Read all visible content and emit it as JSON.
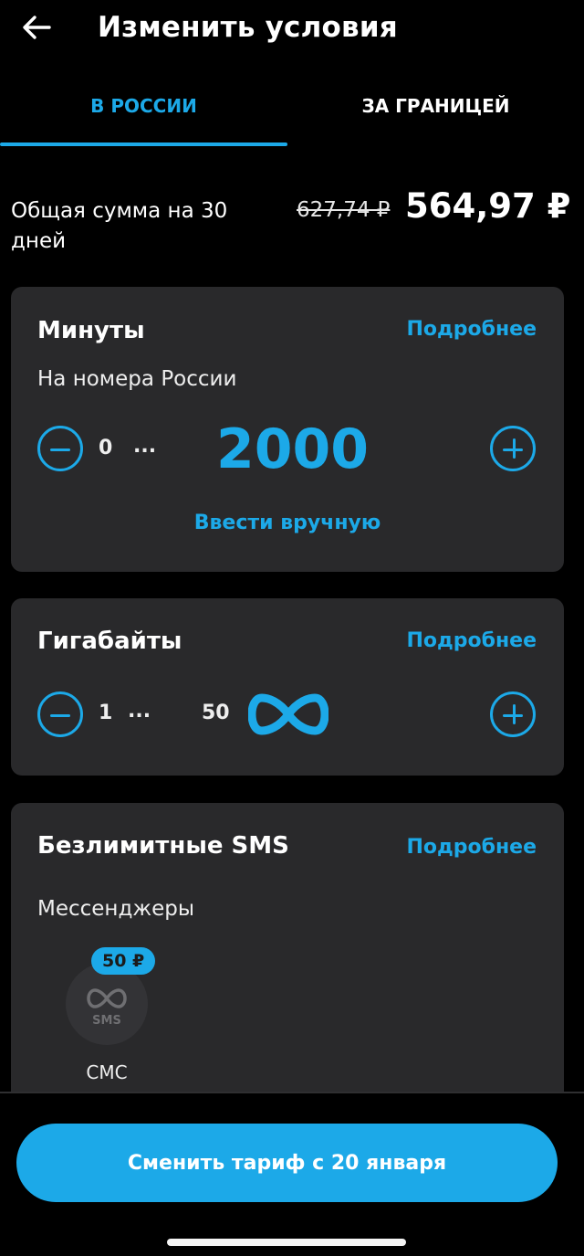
{
  "header": {
    "title": "Изменить условия",
    "back_icon": "arrow-left-icon"
  },
  "tabs": [
    {
      "label": "В РОССИИ",
      "active": true
    },
    {
      "label": "ЗА ГРАНИЦЕЙ",
      "active": false
    }
  ],
  "summary": {
    "label": "Общая сумма на 30 дней",
    "old_price": "627,74 ₽",
    "new_price": "564,97 ₽"
  },
  "minutes": {
    "title": "Минуты",
    "more": "Подробнее",
    "subtitle": "На номера России",
    "min": "0",
    "ellipsis": "...",
    "value": "2000",
    "manual": "Ввести вручную"
  },
  "gigabytes": {
    "title": "Гигабайты",
    "more": "Подробнее",
    "min": "1",
    "ellipsis": "...",
    "max": "50",
    "unlimited_icon": "infinity-icon"
  },
  "sms": {
    "title": "Безлимитные SMS",
    "more": "Подробнее",
    "subtitle": "Мессенджеры",
    "item": {
      "price": "50 ₽",
      "icon_text": "SMS",
      "label": "СМС"
    }
  },
  "cta": {
    "label": "Сменить тариф с 20 января"
  },
  "colors": {
    "accent": "#1ca9e8",
    "card": "#29292b",
    "background": "#000000"
  }
}
